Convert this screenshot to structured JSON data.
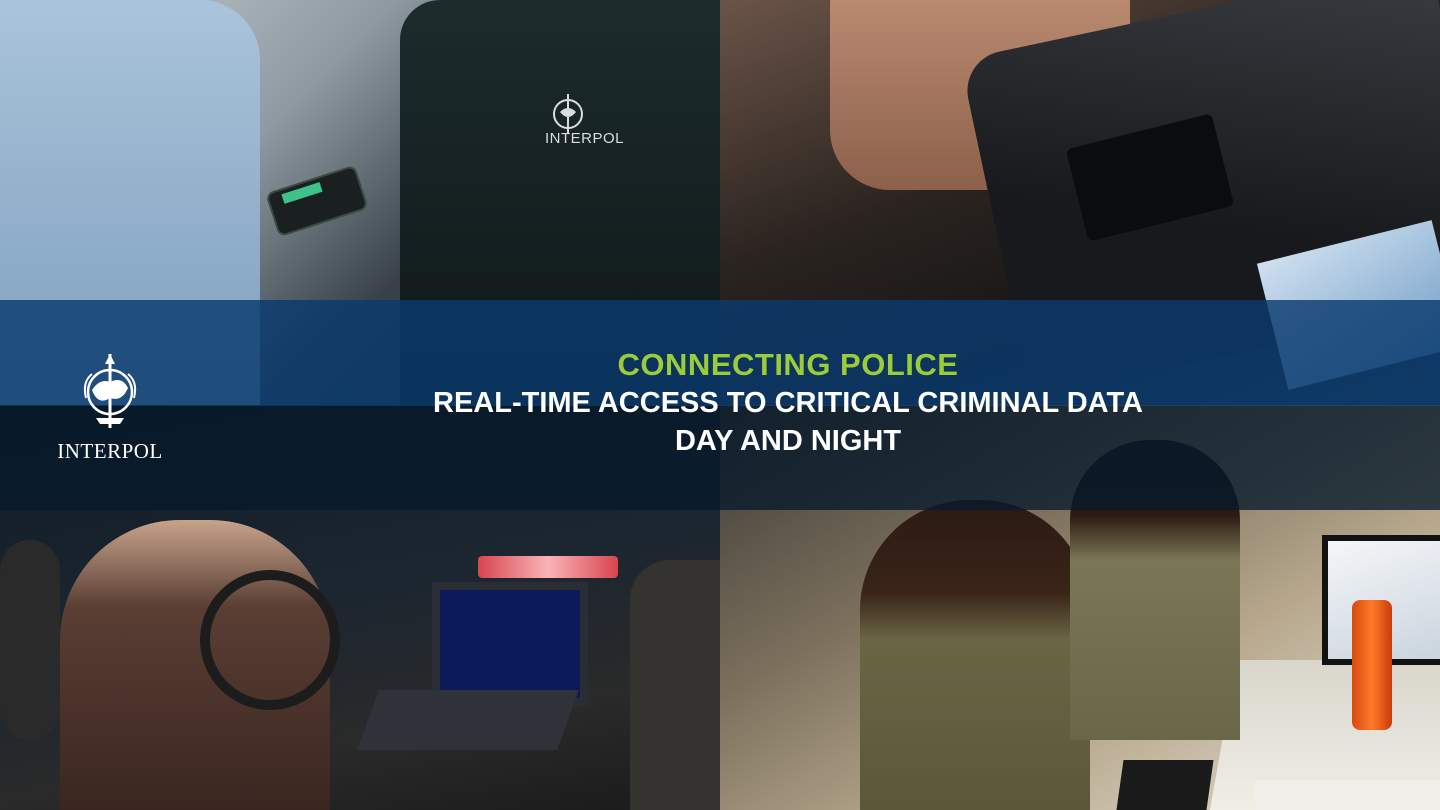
{
  "brand": {
    "name": "INTERPOL",
    "vest_label": "INTERPOL"
  },
  "headline": {
    "title": "CONNECTING POLICE",
    "line1": "REAL-TIME ACCESS TO CRITICAL CRIMINAL DATA",
    "line2": "DAY AND NIGHT"
  },
  "colors": {
    "title_accent": "#9ccc3a",
    "band_blue": "#0a3a6e",
    "band_dark": "#061a2c",
    "text": "#ffffff"
  }
}
